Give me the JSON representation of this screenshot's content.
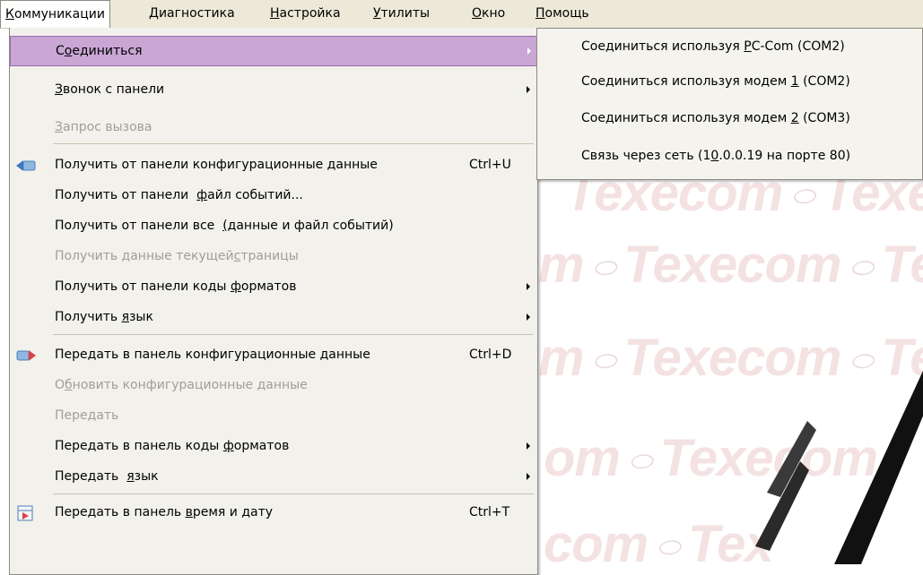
{
  "menubar": [
    {
      "label": "Коммуникации",
      "u": "К",
      "rest": "оммуникации",
      "active": true
    },
    {
      "label": "Диагностика",
      "u": "Д",
      "rest": "иагностика"
    },
    {
      "label": "Настройка",
      "u": "Н",
      "rest": "астройка"
    },
    {
      "label": "Утилиты",
      "u": "У",
      "rest": "тилиты"
    },
    {
      "label": "Окно",
      "u": "О",
      "rest": "кно"
    },
    {
      "label": "Помощь",
      "u": "П",
      "rest": "омощь"
    }
  ],
  "menu": {
    "items": [
      {
        "pre": "С",
        "u": "о",
        "post": "единиться",
        "submenu": true,
        "highlighted": true
      },
      {
        "pre": "",
        "u": "З",
        "post": "вонок с панели",
        "submenu": true
      },
      {
        "pre": "",
        "u": "З",
        "post": "апрос вызова",
        "disabled": true
      },
      {
        "pre": "Получить от панели конфигурационные данные",
        "u": "",
        "post": "",
        "shortcut": "Ctrl+U",
        "icon": "receive-config-icon"
      },
      {
        "pre": "Получить от панели  ",
        "u": "ф",
        "post": "айл событий...",
        "shortcut": ""
      },
      {
        "pre": "Получить от панели все  ",
        "u": "(",
        "post": "данные и файл событий)",
        "shortcut": ""
      },
      {
        "pre": "Получить данные текущей",
        "u": "с",
        "post": "траницы",
        "disabled": true
      },
      {
        "pre": "Получить от панели коды ",
        "u": "ф",
        "post": "орматов",
        "submenu": true
      },
      {
        "pre": "Получить ",
        "u": "я",
        "post": "зык",
        "submenu": true
      },
      {
        "pre": "Передать в панель конфигурационные данные",
        "u": "",
        "post": "",
        "shortcut": "Ctrl+D",
        "icon": "send-config-icon"
      },
      {
        "pre": "О",
        "u": "б",
        "post": "новить конфигурационные данные",
        "disabled": true
      },
      {
        "pre": "Передать",
        "u": "",
        "post": "",
        "disabled": true
      },
      {
        "pre": "Передать в панель коды ",
        "u": "ф",
        "post": "орматов",
        "submenu": true
      },
      {
        "pre": "Передать  ",
        "u": "я",
        "post": "зык",
        "submenu": true
      },
      {
        "pre": "Передать в панель ",
        "u": "в",
        "post": "ремя и дату",
        "shortcut": "Ctrl+T",
        "icon": "send-time-icon"
      }
    ]
  },
  "submenu": {
    "items": [
      {
        "pre": "Соединиться используя ",
        "u": "P",
        "post": "C-Com (COM2)"
      },
      {
        "pre": "Соединиться используя модем ",
        "u": "1",
        "post": " (COM2)"
      },
      {
        "pre": "Соединиться используя модем ",
        "u": "2",
        "post": " (COM3)"
      },
      {
        "pre": "Связь через сеть (1",
        "u": "0",
        "post": ".0.0.19 на порте 80)"
      }
    ]
  },
  "watermark": {
    "brand": "Texecom",
    "left_fragment": "m",
    "left_fragment2": "om",
    "right_fragment": "Tex",
    "bottom_fragment": "com"
  },
  "colors": {
    "menubar_bg": "#ece9d8",
    "menu_bg": "#f2f1ec",
    "highlight": "#c9a6d4",
    "disabled_text": "#a09e95"
  }
}
